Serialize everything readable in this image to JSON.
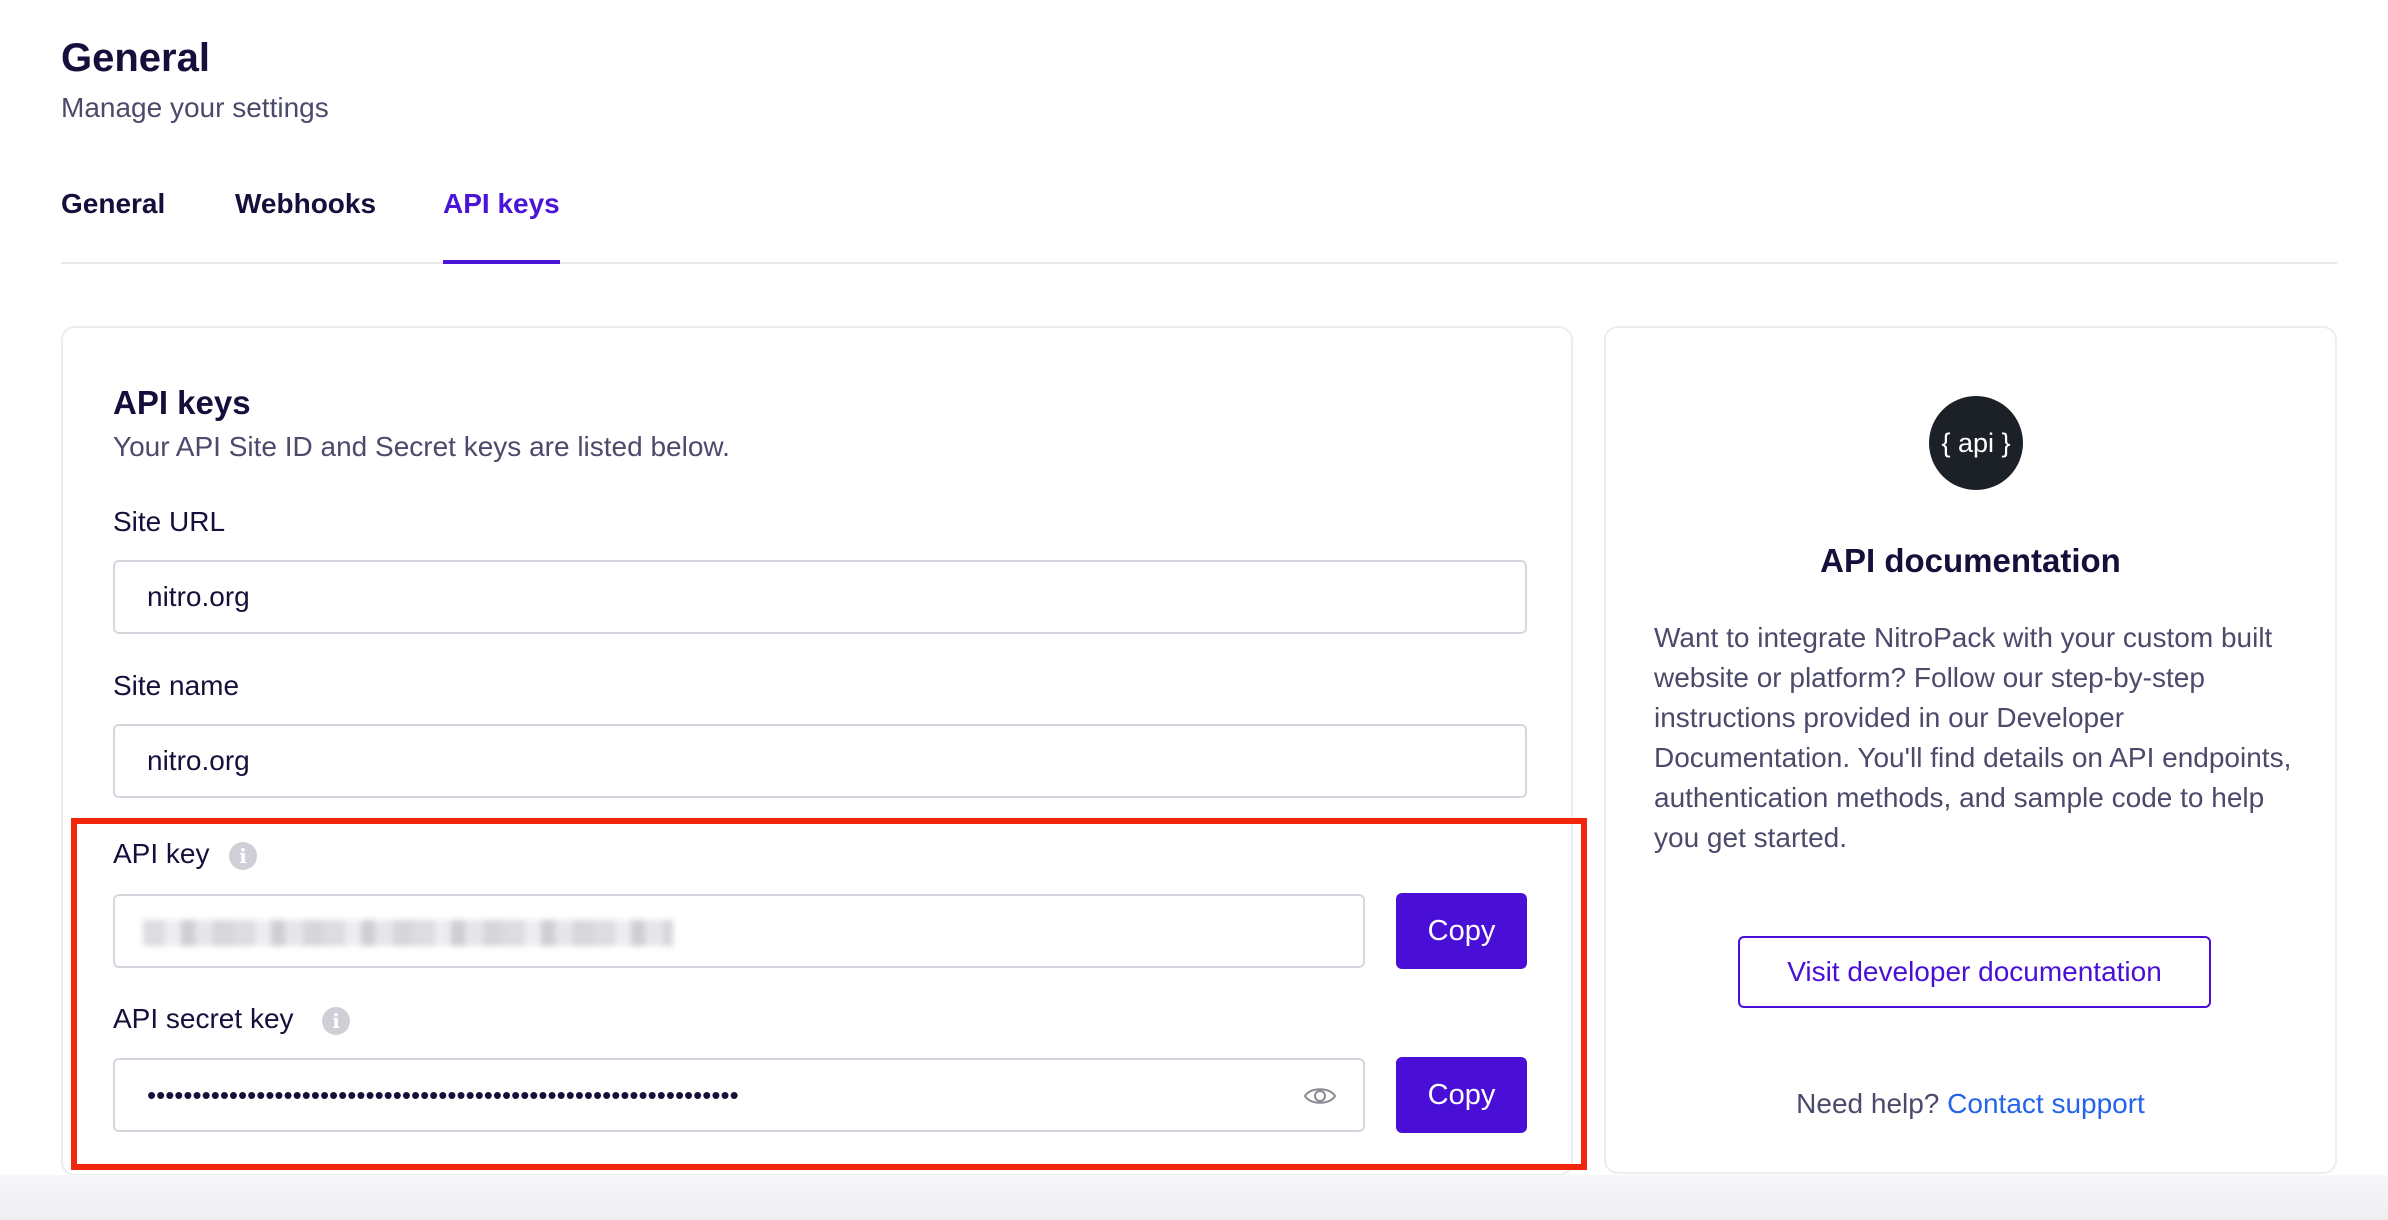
{
  "header": {
    "title": "General",
    "subtitle": "Manage your settings"
  },
  "tabs": [
    {
      "label": "General",
      "active": false
    },
    {
      "label": "Webhooks",
      "active": false
    },
    {
      "label": "API keys",
      "active": true
    }
  ],
  "api_keys_card": {
    "title": "API keys",
    "subtitle": "Your API Site ID and Secret keys are listed below.",
    "site_url": {
      "label": "Site URL",
      "value": "nitro.org"
    },
    "site_name": {
      "label": "Site name",
      "value": "nitro.org"
    },
    "api_key": {
      "label": "API key",
      "info_icon": "i",
      "copy_label": "Copy"
    },
    "api_secret_key": {
      "label": "API secret key",
      "info_icon": "i",
      "value": "•••••••••••••••••••••••••••••••••••••••••••••••••••••••••••••••••",
      "copy_label": "Copy"
    }
  },
  "docs_card": {
    "logo_text": "{ api }",
    "title": "API documentation",
    "description": "Want to integrate NitroPack with your custom built website or platform? Follow our step-by-step instructions provided in our Developer Documentation. You'll find details on API endpoints, authentication methods, and sample code to help you get started.",
    "button_label": "Visit developer documentation",
    "help_text": "Need help?",
    "help_link": "Contact support"
  },
  "colors": {
    "accent": "#4a0fd6",
    "highlight": "#f0270c",
    "link": "#2563eb"
  }
}
